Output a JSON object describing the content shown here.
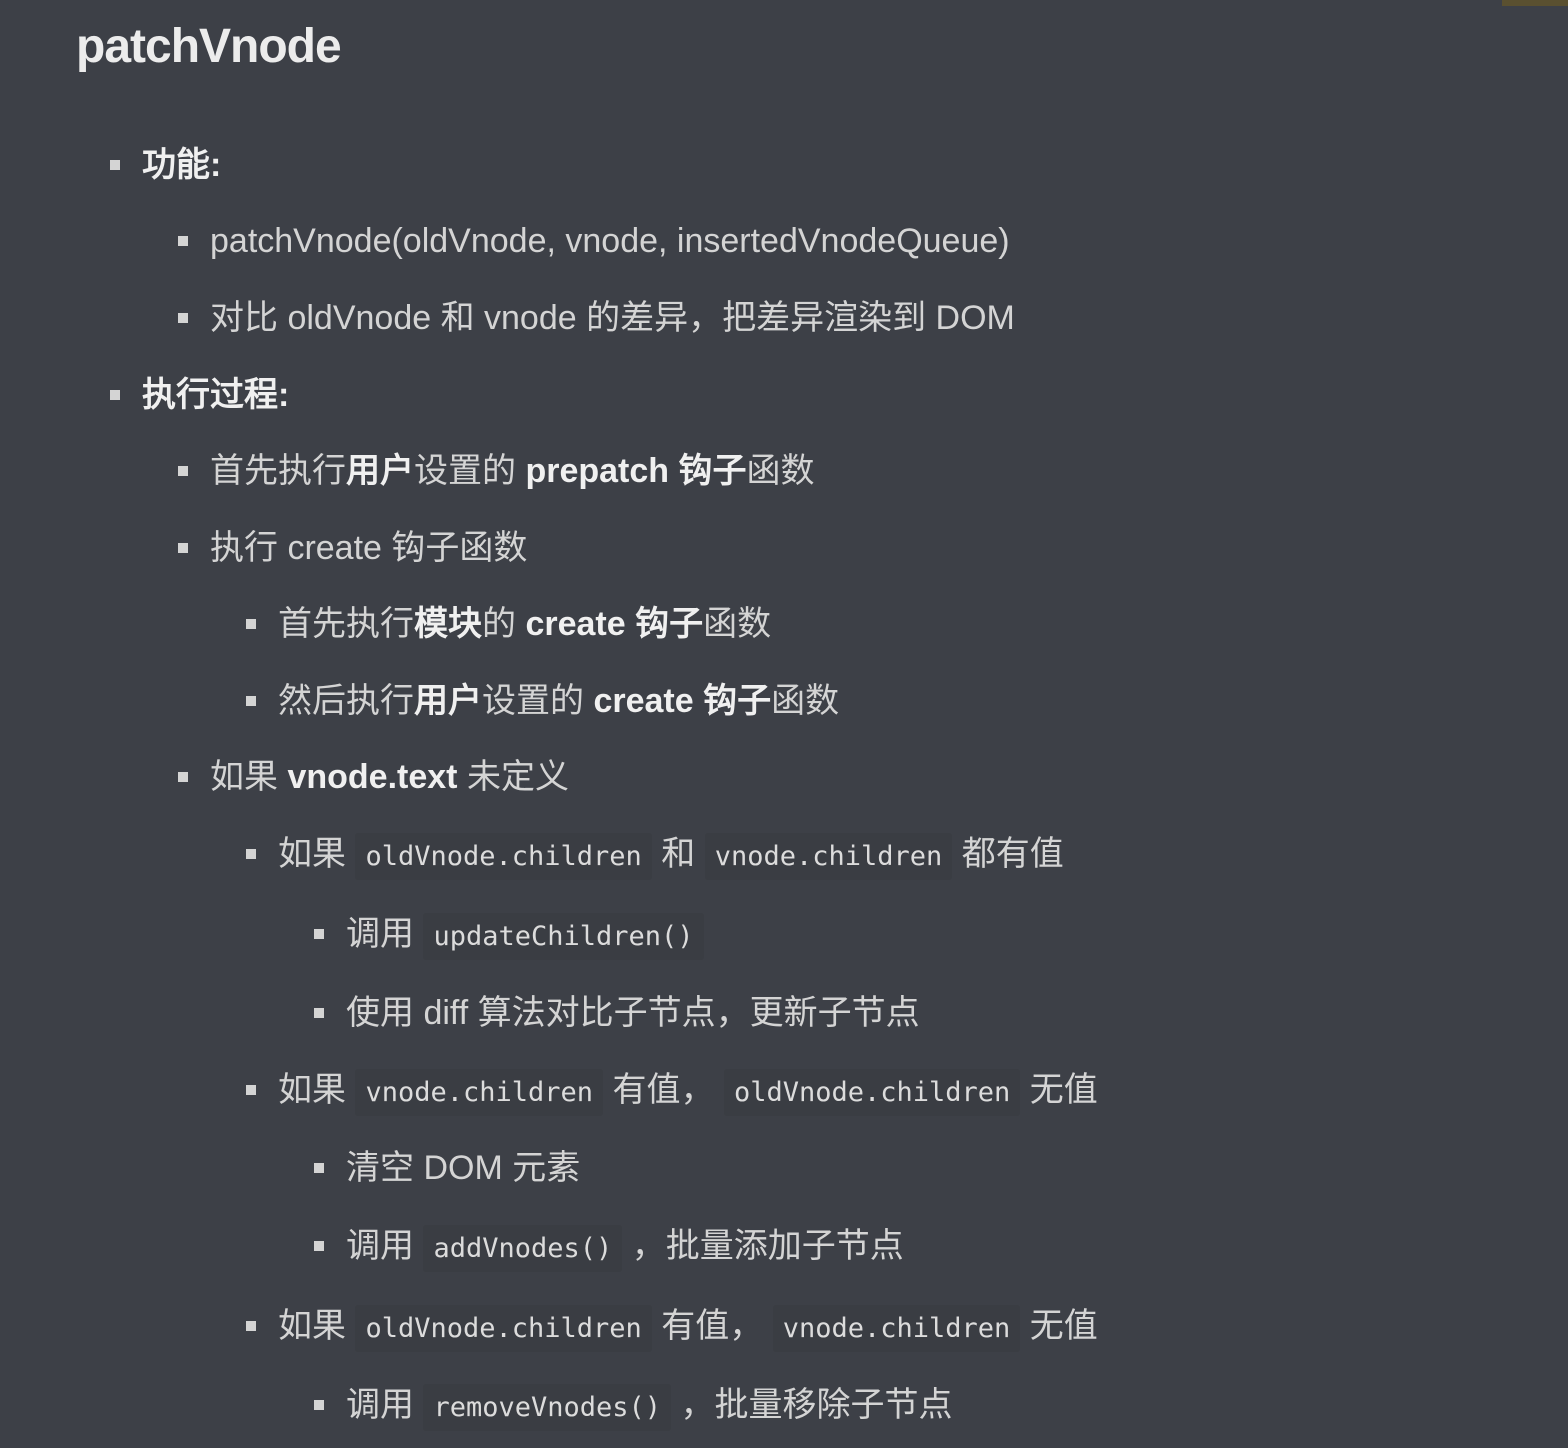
{
  "title": "patchVnode",
  "sections": {
    "function": {
      "heading": "功能:",
      "items": [
        "patchVnode(oldVnode, vnode, insertedVnodeQueue)",
        "对比 oldVnode 和 vnode 的差异，把差异渲染到 DOM"
      ]
    },
    "process": {
      "heading": "执行过程:",
      "prepatch": {
        "p1": "首先执行",
        "p2": "用户",
        "p3": "设置的 ",
        "p4": "prepatch 钩子",
        "p5": "函数"
      },
      "create": {
        "label": "执行 create 钩子函数",
        "module": {
          "p1": "首先执行",
          "p2": "模块",
          "p3": "的 ",
          "p4": "create 钩子",
          "p5": "函数"
        },
        "user": {
          "p1": "然后执行",
          "p2": "用户",
          "p3": "设置的 ",
          "p4": "create 钩子",
          "p5": "函数"
        }
      },
      "text_undefined": {
        "p1": "如果 ",
        "p2": "vnode.text",
        "p3": " 未定义",
        "both": {
          "p1": "如果 ",
          "c1": "oldVnode.children",
          "p2": " 和 ",
          "c2": "vnode.children",
          "p3": " 都有值",
          "call": {
            "p1": "调用 ",
            "c1": "updateChildren()"
          },
          "diff": "使用 diff 算法对比子节点，更新子节点"
        },
        "new_only": {
          "p1": "如果 ",
          "c1": "vnode.children",
          "p2": " 有值， ",
          "c2": "oldVnode.children",
          "p3": " 无值",
          "clear": "清空 DOM 元素",
          "add": {
            "p1": "调用 ",
            "c1": "addVnodes()",
            "p2": " ，批量添加子节点"
          }
        },
        "old_only": {
          "p1": "如果 ",
          "c1": "oldVnode.children",
          "p2": " 有值， ",
          "c2": "vnode.children",
          "p3": " 无值",
          "remove": {
            "p1": "调用 ",
            "c1": "removeVnodes()",
            "p2": " ，批量移除子节点"
          }
        }
      }
    }
  }
}
